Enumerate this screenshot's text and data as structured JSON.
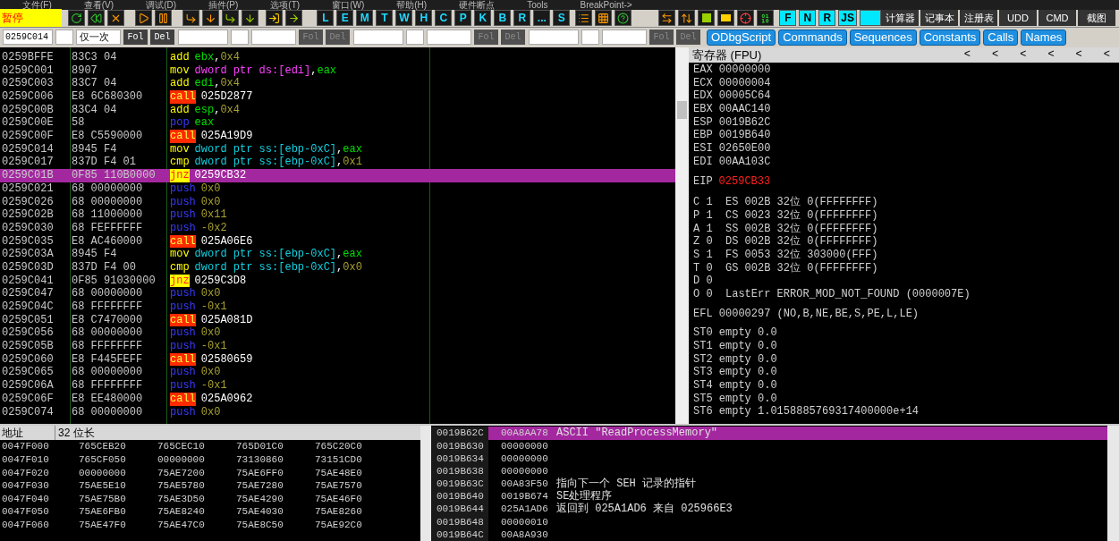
{
  "menu": [
    "文件(F)",
    "查看(V)",
    "调试(D)",
    "插件(P)",
    "选项(T)",
    "窗口(W)",
    "帮助(H)",
    "硬件断点",
    "Tools",
    "BreakPoint->"
  ],
  "status": "暂停",
  "letter_buttons": [
    "L",
    "E",
    "M",
    "T",
    "W",
    "H",
    "C",
    "P",
    "K",
    "B",
    "R",
    "...",
    "S"
  ],
  "plugin_buttons": [
    "F",
    "N",
    "R",
    "JS"
  ],
  "tools": [
    "计算器",
    "记事本",
    "注册表",
    "UDD",
    "CMD",
    "截图"
  ],
  "watch_groups": [
    {
      "address": "0259C014",
      "mode": "仅一次",
      "buttons": [
        {
          "label": "Fol",
          "disabled": false
        },
        {
          "label": "Del",
          "disabled": false
        }
      ]
    },
    {
      "buttons": [
        {
          "label": "Fol",
          "disabled": true
        },
        {
          "label": "Del",
          "disabled": true
        }
      ]
    },
    {
      "buttons": [
        {
          "label": "Fol",
          "disabled": true
        },
        {
          "label": "Del",
          "disabled": true
        }
      ]
    },
    {
      "buttons": [
        {
          "label": "Fol",
          "disabled": true
        },
        {
          "label": "Del",
          "disabled": true
        }
      ]
    }
  ],
  "script_tabs": [
    "ODbgScript",
    "Commands",
    "Sequences",
    "Constants",
    "Calls",
    "Names"
  ],
  "disassembly": [
    {
      "address": "0259BFFE",
      "bytes": "83C3 04",
      "mnemonic": "add",
      "kind": "arith",
      "selected": false,
      "operands": [
        {
          "text": "ebx",
          "kind": "reg"
        },
        {
          "text": ",",
          "kind": "punct"
        },
        {
          "text": "0x4",
          "kind": "imm"
        }
      ]
    },
    {
      "address": "0259C001",
      "bytes": "8907",
      "mnemonic": "mov",
      "kind": "arith",
      "selected": false,
      "operands": [
        {
          "text": "dword ptr ds:[edi]",
          "kind": "mem_ds"
        },
        {
          "text": ",",
          "kind": "punct"
        },
        {
          "text": "eax",
          "kind": "reg"
        }
      ]
    },
    {
      "address": "0259C003",
      "bytes": "83C7 04",
      "mnemonic": "add",
      "kind": "arith",
      "selected": false,
      "operands": [
        {
          "text": "edi",
          "kind": "reg"
        },
        {
          "text": ",",
          "kind": "punct"
        },
        {
          "text": "0x4",
          "kind": "imm"
        }
      ]
    },
    {
      "address": "0259C006",
      "bytes": "E8 6C680300",
      "mnemonic": "call",
      "kind": "call",
      "selected": false,
      "operands": [
        {
          "text": "025D2877",
          "kind": "addr"
        }
      ]
    },
    {
      "address": "0259C00B",
      "bytes": "83C4 04",
      "mnemonic": "add",
      "kind": "arith",
      "selected": false,
      "operands": [
        {
          "text": "esp",
          "kind": "reg"
        },
        {
          "text": ",",
          "kind": "punct"
        },
        {
          "text": "0x4",
          "kind": "imm"
        }
      ]
    },
    {
      "address": "0259C00E",
      "bytes": "58",
      "mnemonic": "pop",
      "kind": "stack",
      "selected": false,
      "operands": [
        {
          "text": "eax",
          "kind": "reg"
        }
      ]
    },
    {
      "address": "0259C00F",
      "bytes": "E8 C5590000",
      "mnemonic": "call",
      "kind": "call",
      "selected": false,
      "operands": [
        {
          "text": "025A19D9",
          "kind": "addr"
        }
      ]
    },
    {
      "address": "0259C014",
      "bytes": "8945 F4",
      "mnemonic": "mov",
      "kind": "arith",
      "selected": false,
      "operands": [
        {
          "text": "dword ptr ss:[ebp-0xC]",
          "kind": "mem_ss"
        },
        {
          "text": ",",
          "kind": "punct"
        },
        {
          "text": "eax",
          "kind": "reg"
        }
      ]
    },
    {
      "address": "0259C017",
      "bytes": "837D F4 01",
      "mnemonic": "cmp",
      "kind": "arith",
      "selected": false,
      "operands": [
        {
          "text": "dword ptr ss:[ebp-0xC]",
          "kind": "mem_ss"
        },
        {
          "text": ",",
          "kind": "punct"
        },
        {
          "text": "0x1",
          "kind": "imm"
        }
      ]
    },
    {
      "address": "0259C01B",
      "bytes": "0F85 110B0000",
      "mnemonic": "jnz",
      "kind": "jump",
      "selected": true,
      "operands": [
        {
          "text": "0259CB32",
          "kind": "addr"
        }
      ]
    },
    {
      "address": "0259C021",
      "bytes": "68 00000000",
      "mnemonic": "push",
      "kind": "stack",
      "selected": false,
      "operands": [
        {
          "text": "0x0",
          "kind": "imm"
        }
      ]
    },
    {
      "address": "0259C026",
      "bytes": "68 00000000",
      "mnemonic": "push",
      "kind": "stack",
      "selected": false,
      "operands": [
        {
          "text": "0x0",
          "kind": "imm"
        }
      ]
    },
    {
      "address": "0259C02B",
      "bytes": "68 11000000",
      "mnemonic": "push",
      "kind": "stack",
      "selected": false,
      "operands": [
        {
          "text": "0x11",
          "kind": "imm"
        }
      ]
    },
    {
      "address": "0259C030",
      "bytes": "68 FEFFFFFF",
      "mnemonic": "push",
      "kind": "stack",
      "selected": false,
      "operands": [
        {
          "text": "-0x2",
          "kind": "imm"
        }
      ]
    },
    {
      "address": "0259C035",
      "bytes": "E8 AC460000",
      "mnemonic": "call",
      "kind": "call",
      "selected": false,
      "operands": [
        {
          "text": "025A06E6",
          "kind": "addr"
        }
      ]
    },
    {
      "address": "0259C03A",
      "bytes": "8945 F4",
      "mnemonic": "mov",
      "kind": "arith",
      "selected": false,
      "operands": [
        {
          "text": "dword ptr ss:[ebp-0xC]",
          "kind": "mem_ss"
        },
        {
          "text": ",",
          "kind": "punct"
        },
        {
          "text": "eax",
          "kind": "reg"
        }
      ]
    },
    {
      "address": "0259C03D",
      "bytes": "837D F4 00",
      "mnemonic": "cmp",
      "kind": "arith",
      "selected": false,
      "operands": [
        {
          "text": "dword ptr ss:[ebp-0xC]",
          "kind": "mem_ss"
        },
        {
          "text": ",",
          "kind": "punct"
        },
        {
          "text": "0x0",
          "kind": "imm"
        }
      ]
    },
    {
      "address": "0259C041",
      "bytes": "0F85 91030000",
      "mnemonic": "jnz",
      "kind": "jump",
      "selected": false,
      "operands": [
        {
          "text": "0259C3D8",
          "kind": "addr"
        }
      ]
    },
    {
      "address": "0259C047",
      "bytes": "68 00000000",
      "mnemonic": "push",
      "kind": "stack",
      "selected": false,
      "operands": [
        {
          "text": "0x0",
          "kind": "imm"
        }
      ]
    },
    {
      "address": "0259C04C",
      "bytes": "68 FFFFFFFF",
      "mnemonic": "push",
      "kind": "stack",
      "selected": false,
      "operands": [
        {
          "text": "-0x1",
          "kind": "imm"
        }
      ]
    },
    {
      "address": "0259C051",
      "bytes": "E8 C7470000",
      "mnemonic": "call",
      "kind": "call",
      "selected": false,
      "operands": [
        {
          "text": "025A081D",
          "kind": "addr"
        }
      ]
    },
    {
      "address": "0259C056",
      "bytes": "68 00000000",
      "mnemonic": "push",
      "kind": "stack",
      "selected": false,
      "operands": [
        {
          "text": "0x0",
          "kind": "imm"
        }
      ]
    },
    {
      "address": "0259C05B",
      "bytes": "68 FFFFFFFF",
      "mnemonic": "push",
      "kind": "stack",
      "selected": false,
      "operands": [
        {
          "text": "-0x1",
          "kind": "imm"
        }
      ]
    },
    {
      "address": "0259C060",
      "bytes": "E8 F445FEFF",
      "mnemonic": "call",
      "kind": "call",
      "selected": false,
      "operands": [
        {
          "text": "02580659",
          "kind": "addr"
        }
      ]
    },
    {
      "address": "0259C065",
      "bytes": "68 00000000",
      "mnemonic": "push",
      "kind": "stack",
      "selected": false,
      "operands": [
        {
          "text": "0x0",
          "kind": "imm"
        }
      ]
    },
    {
      "address": "0259C06A",
      "bytes": "68 FFFFFFFF",
      "mnemonic": "push",
      "kind": "stack",
      "selected": false,
      "operands": [
        {
          "text": "-0x1",
          "kind": "imm"
        }
      ]
    },
    {
      "address": "0259C06F",
      "bytes": "E8 EE480000",
      "mnemonic": "call",
      "kind": "call",
      "selected": false,
      "operands": [
        {
          "text": "025A0962",
          "kind": "addr"
        }
      ]
    },
    {
      "address": "0259C074",
      "bytes": "68 00000000",
      "mnemonic": "push",
      "kind": "stack",
      "selected": false,
      "operands": [
        {
          "text": "0x0",
          "kind": "imm"
        }
      ]
    }
  ],
  "registers": {
    "title": "寄存器 (FPU)",
    "nav": [
      "<",
      "<",
      "<",
      "<",
      "<",
      "<"
    ],
    "general": [
      {
        "name": "EAX",
        "value": "00000000"
      },
      {
        "name": "ECX",
        "value": "00000004"
      },
      {
        "name": "EDX",
        "value": "00005C64"
      },
      {
        "name": "EBX",
        "value": "00AAC140"
      },
      {
        "name": "ESP",
        "value": "0019B62C"
      },
      {
        "name": "EBP",
        "value": "0019B640"
      },
      {
        "name": "ESI",
        "value": "02650E00"
      },
      {
        "name": "EDI",
        "value": "00AA103C"
      }
    ],
    "eip": {
      "name": "EIP",
      "value": "0259CB33",
      "changed": true
    },
    "flags": [
      {
        "name": "C",
        "value": "1",
        "detail": "ES 002B 32位 0(FFFFFFFF)"
      },
      {
        "name": "P",
        "value": "1",
        "detail": "CS 0023 32位 0(FFFFFFFF)"
      },
      {
        "name": "A",
        "value": "1",
        "detail": "SS 002B 32位 0(FFFFFFFF)"
      },
      {
        "name": "Z",
        "value": "0",
        "detail": "DS 002B 32位 0(FFFFFFFF)"
      },
      {
        "name": "S",
        "value": "1",
        "detail": "FS 0053 32位 303000(FFF)"
      },
      {
        "name": "T",
        "value": "0",
        "detail": "GS 002B 32位 0(FFFFFFFF)"
      },
      {
        "name": "D",
        "value": "0"
      },
      {
        "name": "O",
        "value": "0",
        "detail": "LastErr ERROR_MOD_NOT_FOUND (0000007E)"
      }
    ],
    "efl": {
      "name": "EFL",
      "value": "00000297",
      "detail": "(NO,B,NE,BE,S,PE,L,LE)"
    },
    "fpu": [
      {
        "name": "ST0",
        "tag": "empty",
        "value": "0.0"
      },
      {
        "name": "ST1",
        "tag": "empty",
        "value": "0.0"
      },
      {
        "name": "ST2",
        "tag": "empty",
        "value": "0.0"
      },
      {
        "name": "ST3",
        "tag": "empty",
        "value": "0.0"
      },
      {
        "name": "ST4",
        "tag": "empty",
        "value": "0.0"
      },
      {
        "name": "ST5",
        "tag": "empty",
        "value": "0.0"
      },
      {
        "name": "ST6",
        "tag": "empty",
        "value": "1.0158885769317400000e+14"
      }
    ]
  },
  "dump": {
    "columns": [
      "地址",
      "32 位长"
    ],
    "rows": [
      [
        "0047F000",
        "765CEB20",
        "765CEC10",
        "765D01C0",
        "765C20C0"
      ],
      [
        "0047F010",
        "765CF050",
        "00000000",
        "73130860",
        "73151CD0"
      ],
      [
        "0047F020",
        "00000000",
        "75AE7200",
        "75AE6FF0",
        "75AE48E0"
      ],
      [
        "0047F030",
        "75AE5E10",
        "75AE5780",
        "75AE7280",
        "75AE7570"
      ],
      [
        "0047F040",
        "75AE75B0",
        "75AE3D50",
        "75AE4290",
        "75AE46F0"
      ],
      [
        "0047F050",
        "75AE6FB0",
        "75AE8240",
        "75AE4030",
        "75AE8260"
      ],
      [
        "0047F060",
        "75AE47F0",
        "75AE47C0",
        "75AE8C50",
        "75AE92C0"
      ]
    ]
  },
  "stack": [
    {
      "address": "0019B62C",
      "value": "00A8AA78",
      "comment": "ASCII \"ReadProcessMemory\"",
      "selected": true
    },
    {
      "address": "0019B630",
      "value": "00000000",
      "selected": false
    },
    {
      "address": "0019B634",
      "value": "00000000",
      "selected": false
    },
    {
      "address": "0019B638",
      "value": "00000000",
      "selected": false
    },
    {
      "address": "0019B63C",
      "value": "00A83F50",
      "comment": "指向下一个 SEH 记录的指针",
      "selected": false
    },
    {
      "address": "0019B640",
      "value": "0019B674",
      "comment": "SE处理程序",
      "selected": false
    },
    {
      "address": "0019B644",
      "value": "025A1AD6",
      "comment": "返回到 025A1AD6 来自 025966E3",
      "selected": false
    },
    {
      "address": "0019B648",
      "value": "00000010",
      "selected": false
    },
    {
      "address": "0019B64C",
      "value": "00A8A930",
      "selected": false
    }
  ]
}
